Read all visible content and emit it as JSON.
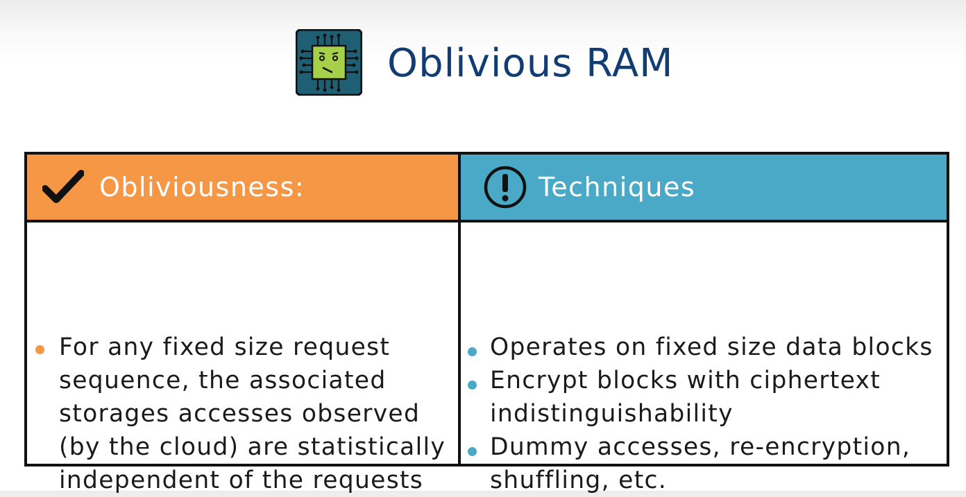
{
  "title": "Oblivious RAM",
  "colors": {
    "title": "#123d73",
    "left_header": "#f69745",
    "right_header": "#4aa9c6",
    "border": "#111111"
  },
  "icons": {
    "title_icon": "chip-icon",
    "left_header_icon": "checkmark-icon",
    "right_header_icon": "exclamation-circle-icon"
  },
  "left": {
    "header": "Obliviousness:",
    "lines": [
      "For any fixed size request",
      "sequence, the associated",
      "storages accesses observed",
      "(by the cloud) are statistically",
      "independent of the requests"
    ]
  },
  "right": {
    "header": "Techniques",
    "bullets": [
      {
        "lines": [
          "Operates on fixed size data blocks"
        ]
      },
      {
        "lines": [
          "Encrypt blocks with ciphertext",
          "indistinguishability"
        ]
      },
      {
        "lines": [
          "Dummy accesses, re-encryption,",
          "shuffling, etc."
        ]
      }
    ]
  }
}
